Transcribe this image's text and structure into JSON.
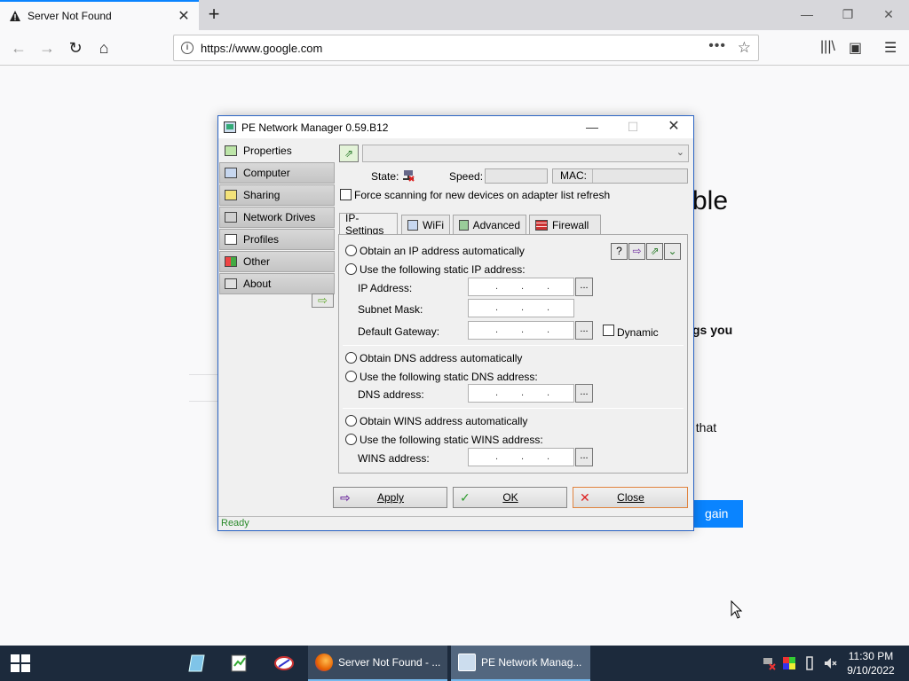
{
  "browser": {
    "tab_title": "Server Not Found",
    "url": "https://www.google.com"
  },
  "page_fragments": {
    "f1": "ble",
    "f2": "gs you",
    "f3": "t that",
    "try_again": "gain"
  },
  "dialog": {
    "title": "PE Network Manager 0.59.B12",
    "nav": [
      {
        "label": "Properties",
        "icon": "properties-icon"
      },
      {
        "label": "Computer",
        "icon": "computer-icon"
      },
      {
        "label": "Sharing",
        "icon": "sharing-icon"
      },
      {
        "label": "Network Drives",
        "icon": "network-drives-icon"
      },
      {
        "label": "Profiles",
        "icon": "profiles-icon"
      },
      {
        "label": "Other",
        "icon": "other-icon"
      },
      {
        "label": "About",
        "icon": "about-icon"
      }
    ],
    "state_label": "State:",
    "speed_label": "Speed:",
    "mac_label": "MAC:",
    "force_scan": "Force scanning for new devices on adapter list refresh",
    "tabs": [
      "IP-Settings",
      "WiFi",
      "Advanced",
      "Firewall"
    ],
    "ip": {
      "auto_ip": "Obtain an IP address automatically",
      "static_ip": "Use the following static IP address:",
      "ip_address": "IP Address:",
      "subnet_mask": "Subnet Mask:",
      "default_gateway": "Default Gateway:",
      "dynamic": "Dynamic",
      "auto_dns": "Obtain DNS address automatically",
      "static_dns": "Use the following static DNS address:",
      "dns_address": "DNS address:",
      "auto_wins": "Obtain WINS address automatically",
      "static_wins": "Use the following static WINS address:",
      "wins_address": "WINS address:",
      "ellipsis": "..."
    },
    "buttons": {
      "apply": "Apply",
      "ok": "OK",
      "close": "Close"
    },
    "status": "Ready"
  },
  "taskbar": {
    "task1": "Server Not Found - ...",
    "task2": "PE Network Manag...",
    "time": "11:30 PM",
    "date": "9/10/2022"
  }
}
